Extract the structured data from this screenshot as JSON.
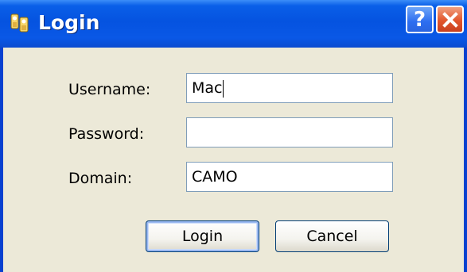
{
  "window": {
    "title": "Login",
    "help_label": "?",
    "accent": "#0553e0"
  },
  "form": {
    "username_label": "Username:",
    "username_value": "Mac",
    "password_label": "Password:",
    "password_value": "",
    "domain_label": "Domain:",
    "domain_value": "CAMO"
  },
  "buttons": {
    "login": "Login",
    "cancel": "Cancel"
  },
  "icons": {
    "app": "users-key-icon",
    "help": "help-icon",
    "close": "close-icon"
  }
}
